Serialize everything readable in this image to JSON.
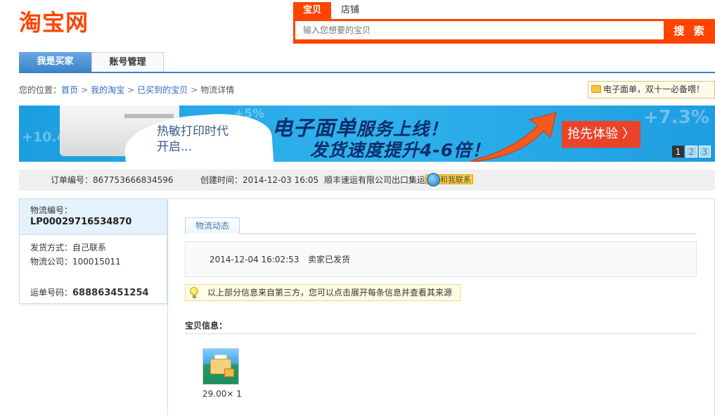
{
  "header": {
    "logo": "淘宝网",
    "search": {
      "tabs": [
        "宝贝",
        "店铺"
      ],
      "placeholder": "输入您想要的宝贝",
      "button": "搜 索"
    }
  },
  "main_tabs": [
    "我是买家",
    "账号管理"
  ],
  "breadcrumb": {
    "prefix": "您的位置：",
    "items": [
      "首页",
      "我的淘宝",
      "已买到的宝贝"
    ],
    "current": "物流详情",
    "separator": ">"
  },
  "promo_link": "电子面单，双十一必备喂！",
  "banner": {
    "left_text_line1": "热敏打印时代",
    "left_text_line2": "开启...",
    "headline_main": "电子面单",
    "headline_tail": "服务上线！",
    "subline": "发货速度提升4-6倍！",
    "cta": "抢先体验",
    "decor_numbers": [
      "+10.4%",
      "+5%",
      "+7.3%"
    ],
    "pages": [
      "1",
      "2",
      "3"
    ],
    "active_page": "1"
  },
  "order": {
    "number_label": "订单编号：",
    "number": "867753666834596",
    "created_label": "创建时间：",
    "created": "2014-12-03 16:05",
    "seller": "顺丰速运有限公司出口集运",
    "contact": "和我联系"
  },
  "logistics_panel": {
    "id_label": "物流编号：",
    "id": "LP00029716534870",
    "ship_method_label": "发货方式：",
    "ship_method": "自己联系",
    "company_label": "物流公司：",
    "company": "100015011",
    "waybill_label": "运单号码：",
    "waybill": "688863451254"
  },
  "tracking": {
    "tab": "物流动态",
    "events": [
      {
        "time": "2014-12-04 16:02:53",
        "status": "卖家已发货"
      }
    ],
    "tip": "以上部分信息来自第三方，您可以点击展开每条信息并查看其来源"
  },
  "goods": {
    "title": "宝贝信息：",
    "items": [
      {
        "price_qty": "29.00× 1"
      }
    ]
  },
  "colors": {
    "brand": "#ff4400",
    "tab_blue": "#3b86c8",
    "link": "#3366cc"
  }
}
